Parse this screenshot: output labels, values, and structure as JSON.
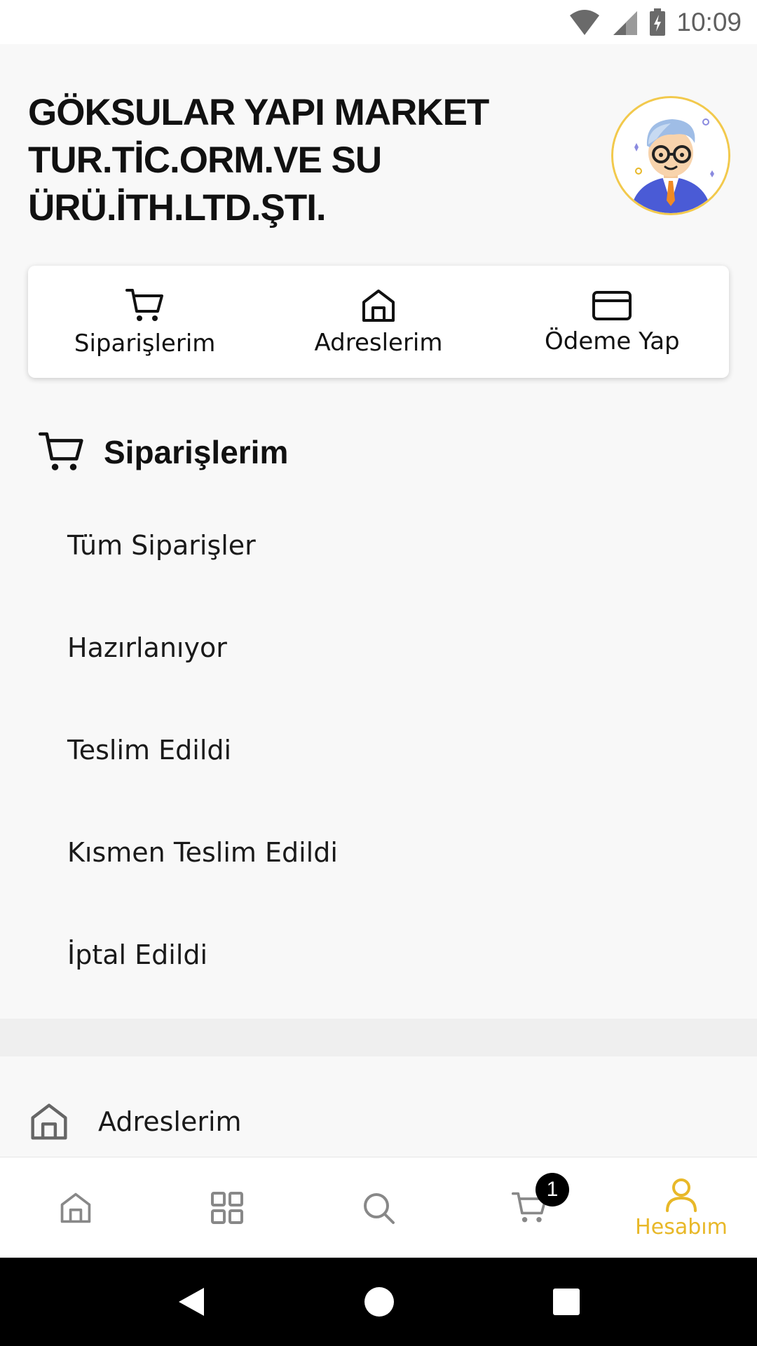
{
  "status_bar": {
    "time": "10:09",
    "icons": [
      "wifi-icon",
      "cell-signal-icon",
      "battery-charging-icon"
    ]
  },
  "header": {
    "company_name_lines": [
      "GÖKSULAR YAPI MARKET",
      "TUR.TİC.ORM.VE SU",
      "ÜRÜ.İTH.LTD.ŞTI."
    ],
    "avatar_icon": "businessman-avatar-icon"
  },
  "quick_actions": [
    {
      "label": "Siparişlerim",
      "icon": "cart-icon"
    },
    {
      "label": "Adreslerim",
      "icon": "home-icon"
    },
    {
      "label": "Ödeme Yap",
      "icon": "credit-card-icon"
    }
  ],
  "orders_section": {
    "title": "Siparişlerim",
    "icon": "cart-icon",
    "items": [
      "Tüm Siparişler",
      "Hazırlanıyor",
      "Teslim Edildi",
      "Kısmen Teslim Edildi",
      "İptal Edildi"
    ]
  },
  "addresses_section": {
    "title": "Adreslerim",
    "icon": "home-icon"
  },
  "bottom_nav": {
    "items": [
      {
        "icon": "home-icon",
        "label": ""
      },
      {
        "icon": "grid-icon",
        "label": ""
      },
      {
        "icon": "search-icon",
        "label": ""
      },
      {
        "icon": "cart-icon",
        "label": "",
        "badge": "1"
      },
      {
        "icon": "user-icon",
        "label": "Hesabım",
        "active": true
      }
    ],
    "active_color": "#e8b828"
  },
  "system_nav": [
    "back-icon",
    "home-circle-icon",
    "recents-icon"
  ]
}
